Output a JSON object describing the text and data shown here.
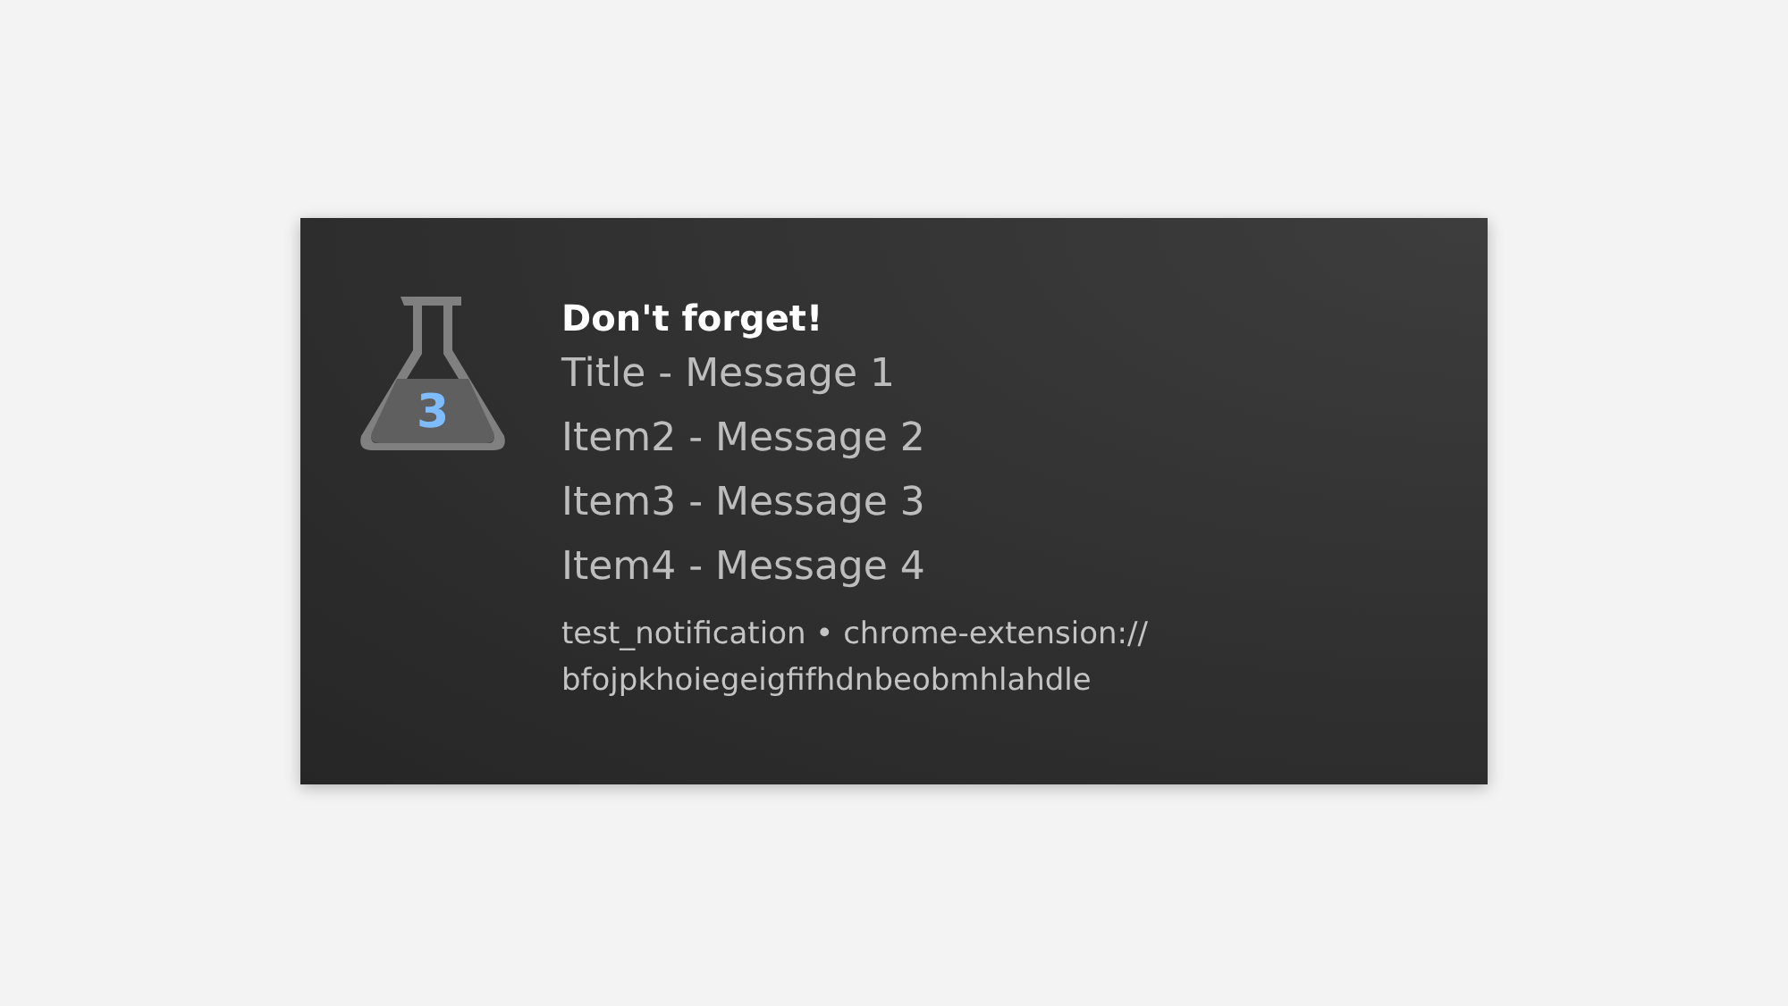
{
  "notification": {
    "icon_number": "3",
    "title": "Don't forget!",
    "items": [
      "Title - Message 1",
      "Item2 - Message 2",
      "Item3 - Message 3",
      "Item4 - Message 4"
    ],
    "source": "test_notification • chrome-extension://",
    "source_id": "bfojpkhoiegeigfifhdnbeobmhlahdle"
  }
}
